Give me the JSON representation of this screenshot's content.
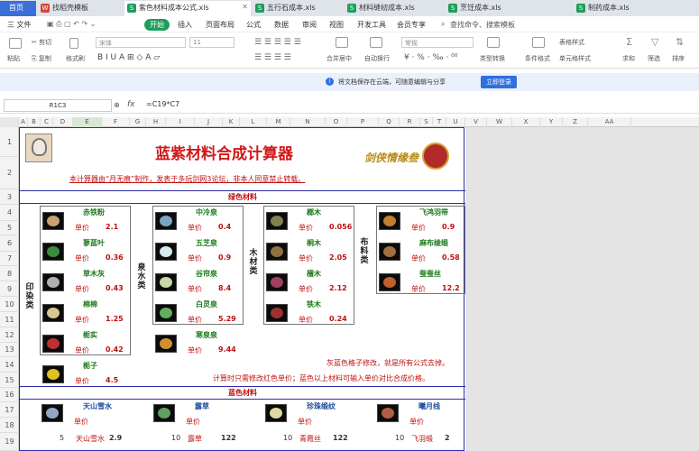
{
  "tabs": [
    {
      "label": "首页",
      "color": "#3b6fd8"
    },
    {
      "label": "找稻壳模板",
      "color": "#d9443b"
    },
    {
      "label": "紫色材料成本公式.xls",
      "color": "#1e9d5c",
      "active": true
    },
    {
      "label": "五行石成本.xls",
      "color": "#1e9d5c"
    },
    {
      "label": "材料缝纫成本.xls",
      "color": "#1e9d5c"
    },
    {
      "label": "烹饪成本.xls",
      "color": "#1e9d5c"
    },
    {
      "label": "制药成本.xls",
      "color": "#1e9d5c"
    }
  ],
  "menu": {
    "file": "三 文件",
    "items": [
      "开始",
      "插入",
      "页面布局",
      "公式",
      "数据",
      "审阅",
      "视图",
      "开发工具",
      "会员专享"
    ],
    "search": "查找命令、搜索模板"
  },
  "ribbon": {
    "paste": "粘贴",
    "cut": "剪切",
    "copy": "复制",
    "format_painter": "格式刷",
    "font": "宋体",
    "size": "11",
    "merge": "合并居中",
    "wrap": "自动换行",
    "numfmt": "常规",
    "convert": "类型转换",
    "cond": "条件格式",
    "table_style": "表格样式",
    "cell_style": "单元格样式",
    "sum": "求和",
    "filter": "筛选",
    "sort": "排序"
  },
  "notice": {
    "text": "将文档保存在云端，可随意编辑与分享",
    "button": "立即登录"
  },
  "formula_bar": {
    "namebox": "R1C3",
    "fx": "fx",
    "formula": "=C19*C7"
  },
  "columns": [
    "A",
    "B",
    "C",
    "D",
    "E",
    "F",
    "G",
    "H",
    "I",
    "J",
    "K",
    "L",
    "M",
    "N",
    "O",
    "P",
    "Q",
    "R",
    "S",
    "T",
    "U",
    "V",
    "W",
    "X",
    "Y",
    "Z",
    "AA"
  ],
  "rows": [
    "1",
    "2",
    "3",
    "4",
    "5",
    "6",
    "7",
    "8",
    "9",
    "10",
    "11",
    "12",
    "13",
    "14",
    "15",
    "16",
    "17",
    "18",
    "19"
  ],
  "sheet": {
    "title": "蓝紫材料合成计算器",
    "subtitle": "本计算器由“月无痕”制作，发表于多玩剑网3论坛，非本人同意禁止转载。",
    "logo_text": "剑侠情缘叁",
    "section_green": "绿色材料",
    "section_blue": "蓝色材料",
    "price_label": "单价",
    "cat_dye": "印染类",
    "cat_water": "泉水类",
    "cat_wood": "木材类",
    "cat_cloth": "布料类",
    "dye": [
      {
        "name": "赤铁粉",
        "price": "2.1",
        "color": "#c9a070"
      },
      {
        "name": "蓼蓝叶",
        "price": "0.36",
        "color": "#3c8a3c"
      },
      {
        "name": "草木灰",
        "price": "0.43",
        "color": "#b0b0b0"
      },
      {
        "name": "棉棉",
        "price": "1.25",
        "color": "#d8c890"
      },
      {
        "name": "栀实",
        "price": "0.42",
        "color": "#c03030"
      },
      {
        "name": "栀子",
        "price": "4.5",
        "color": "#e0c020"
      }
    ],
    "water": [
      {
        "name": "中冷泉",
        "price": "0.4",
        "color": "#7aa7c0"
      },
      {
        "name": "五芝泉",
        "price": "0.9",
        "color": "#d8e8f0"
      },
      {
        "name": "谷帘泉",
        "price": "8.4",
        "color": "#c8d8a8"
      },
      {
        "name": "白灵泉",
        "price": "5.29",
        "color": "#60b060"
      },
      {
        "name": "寒泉泉",
        "price": "9.44",
        "color": "#d09030"
      }
    ],
    "wood": [
      {
        "name": "榔木",
        "price": "0.056",
        "color": "#808050"
      },
      {
        "name": "桐木",
        "price": "2.05",
        "color": "#907040"
      },
      {
        "name": "檀木",
        "price": "2.12",
        "color": "#a04060"
      },
      {
        "name": "铁木",
        "price": "0.24",
        "color": "#a03030"
      }
    ],
    "cloth": [
      {
        "name": "飞鸿羽带",
        "price": "0.9",
        "color": "#c08030"
      },
      {
        "name": "麻布绫缎",
        "price": "0.58",
        "color": "#a07040"
      },
      {
        "name": "蚕蚕丝",
        "price": "12.2",
        "color": "#c06030"
      }
    ],
    "note1": "灰蓝色格子修改，就是所有公式去掉。",
    "note2": "计算时只需修改红色单价；蓝色以上材料可输入单价对比合成价格。",
    "blue": [
      {
        "name": "天山雪水",
        "color": "#90a8c0"
      },
      {
        "name": "露草",
        "color": "#60a060"
      },
      {
        "name": "珍珠缎纹",
        "color": "#e0d8a0"
      },
      {
        "name": "曦月线",
        "color": "#b06040"
      }
    ],
    "row19": [
      {
        "label": "5",
        "name": "天山雪水",
        "value": "2.9"
      },
      {
        "label": "10",
        "name": "露草",
        "value": "122"
      },
      {
        "label": "10",
        "name": "青霞丝",
        "value": "122"
      },
      {
        "label": "10",
        "name": "飞羽缎",
        "value": "2"
      }
    ]
  }
}
